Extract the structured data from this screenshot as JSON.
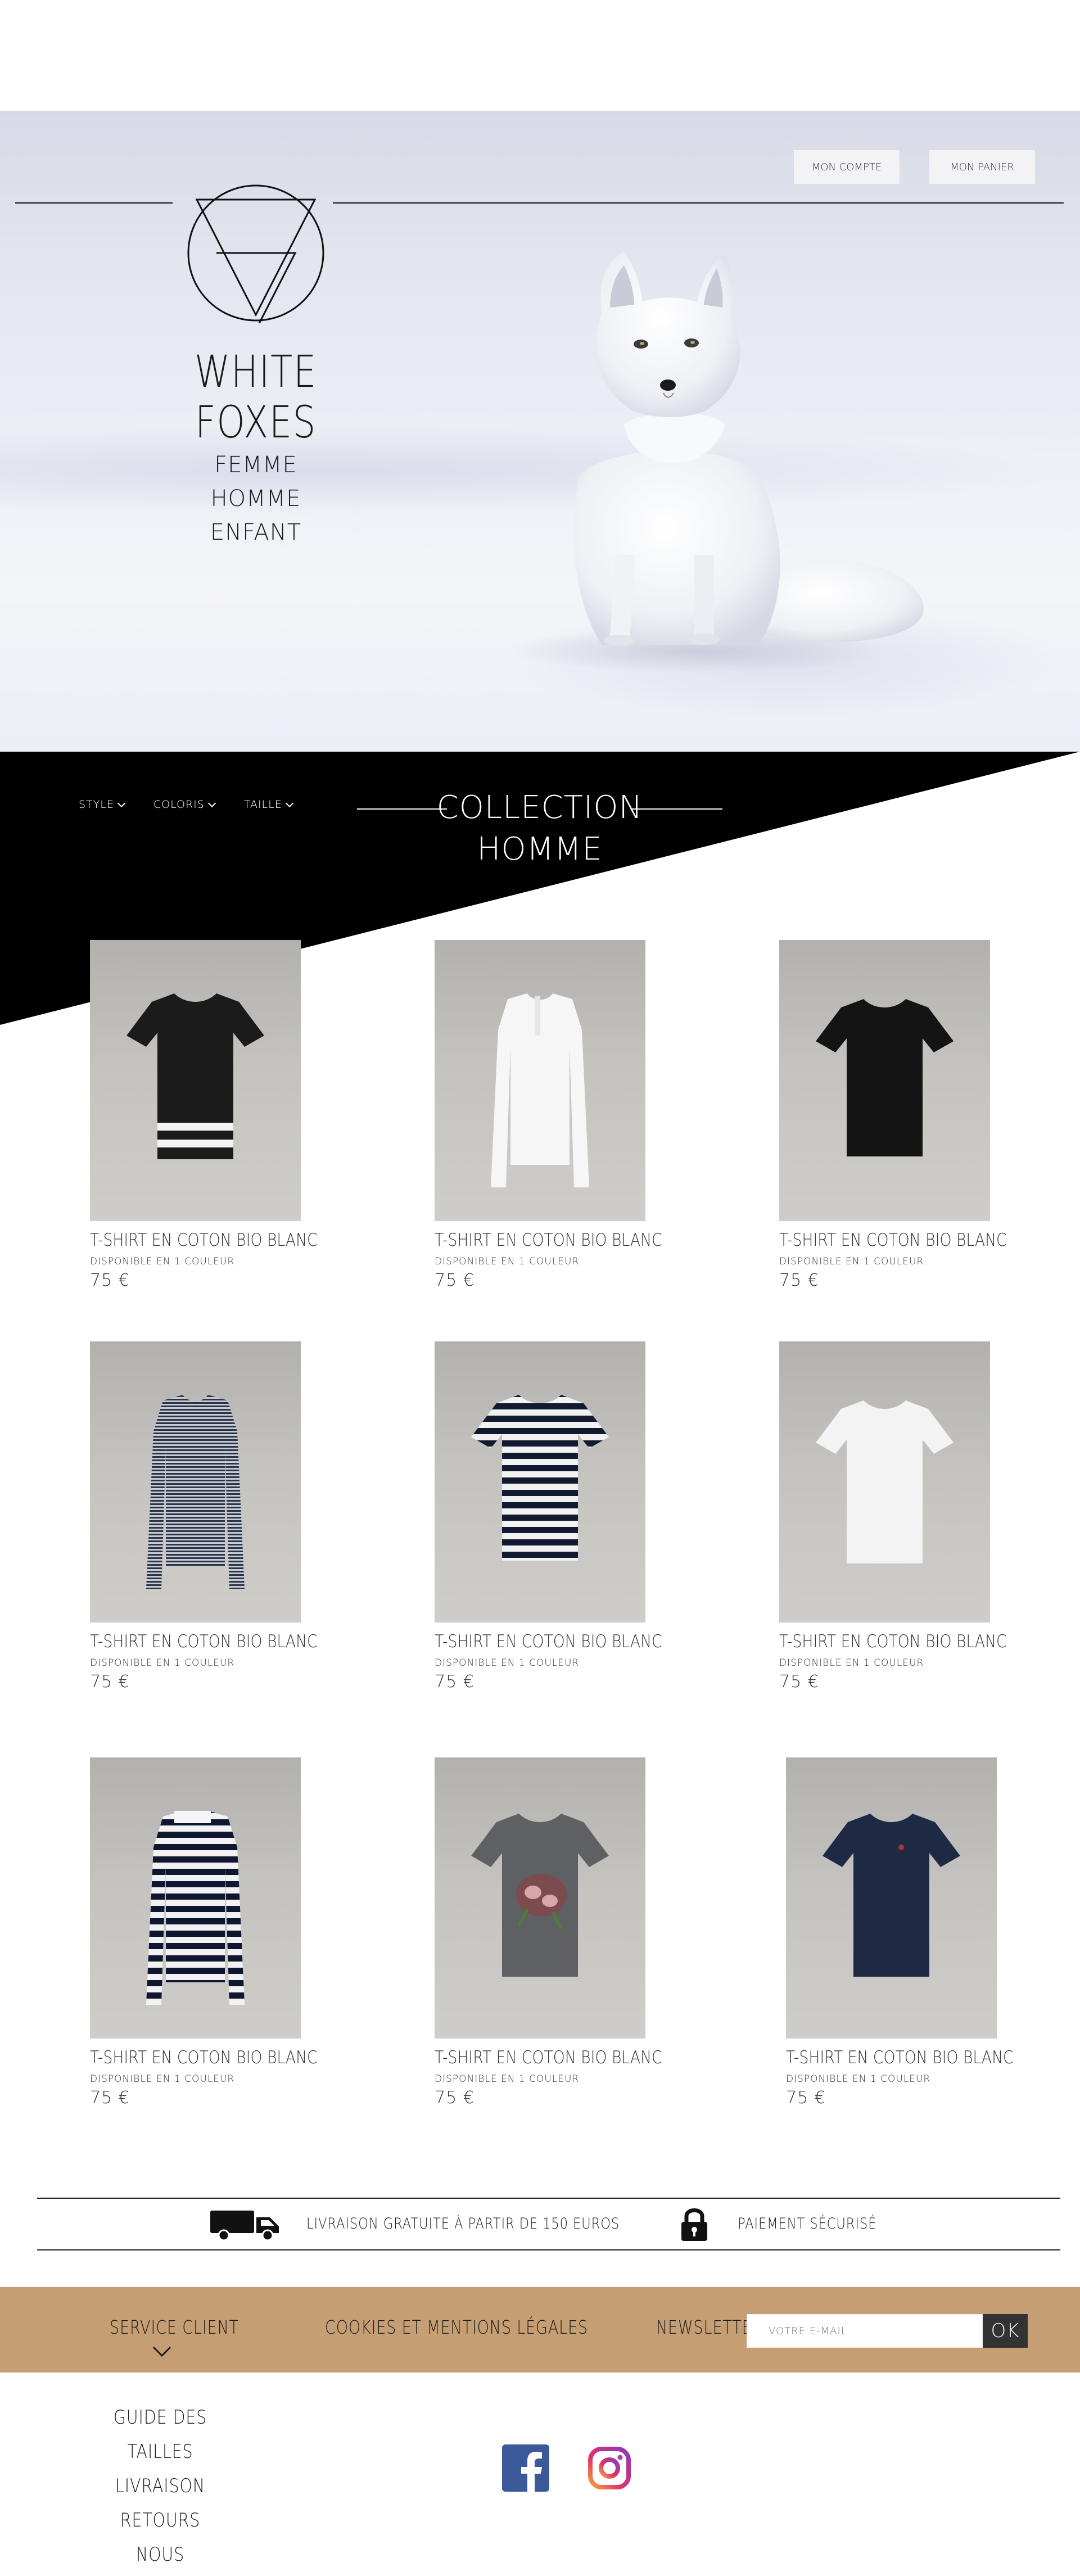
{
  "header": {
    "account_button": "MON COMPTE",
    "cart_button": "MON PANIER",
    "brand": "WHITE FOXES",
    "gender_nav": [
      "FEMME",
      "HOMME",
      "ENFANT"
    ]
  },
  "filters": [
    {
      "label": "STYLE"
    },
    {
      "label": "COLORIS"
    },
    {
      "label": "TAILLE"
    }
  ],
  "collection_title": [
    "COLLECTION",
    "HOMME"
  ],
  "products": [
    {
      "name": "T-SHIRT EN COTON BIO BLANC",
      "availability": "DISPONIBLE EN 1 COULEUR",
      "price": "75 €"
    },
    {
      "name": "T-SHIRT EN COTON BIO BLANC",
      "availability": "DISPONIBLE EN 1 COULEUR",
      "price": "75 €"
    },
    {
      "name": "T-SHIRT EN COTON BIO BLANC",
      "availability": "DISPONIBLE EN 1 COULEUR",
      "price": "75 €"
    },
    {
      "name": "T-SHIRT EN COTON BIO BLANC",
      "availability": "DISPONIBLE EN 1 COULEUR",
      "price": "75 €"
    },
    {
      "name": "T-SHIRT EN COTON BIO BLANC",
      "availability": "DISPONIBLE EN 1 COULEUR",
      "price": "75 €"
    },
    {
      "name": "T-SHIRT EN COTON BIO BLANC",
      "availability": "DISPONIBLE EN 1 COULEUR",
      "price": "75 €"
    },
    {
      "name": "T-SHIRT EN COTON BIO BLANC",
      "availability": "DISPONIBLE EN 1 COULEUR",
      "price": "75 €"
    },
    {
      "name": "T-SHIRT EN COTON BIO BLANC",
      "availability": "DISPONIBLE EN 1 COULEUR",
      "price": "75 €"
    },
    {
      "name": "T-SHIRT EN COTON BIO BLANC",
      "availability": "DISPONIBLE EN 1 COULEUR",
      "price": "75 €"
    }
  ],
  "reassurance": {
    "delivery": "LIVRAISON GRATUITE À PARTIR DE 150 EUROS",
    "payment": "PAIEMENT SÉCURISÉ"
  },
  "footer": {
    "service_client": "SERVICE CLIENT",
    "cookies": "COOKIES ET MENTIONS LÉGALES",
    "newsletter_label": "NEWSLETTER :",
    "newsletter_placeholder": "VOTRE E-MAIL",
    "newsletter_ok": "OK",
    "service_links": [
      "GUIDE DES TAILLES",
      "LIVRAISON",
      "RETOURS",
      "NOUS CONTACTER"
    ]
  },
  "colors": {
    "accent_footer": "#c69e73",
    "band": "#000000",
    "facebook": "#3b5998",
    "instagram": "#e1306c"
  },
  "icons": [
    "truck-icon",
    "padlock-icon",
    "facebook-icon",
    "instagram-icon",
    "chevron-down-icon"
  ]
}
